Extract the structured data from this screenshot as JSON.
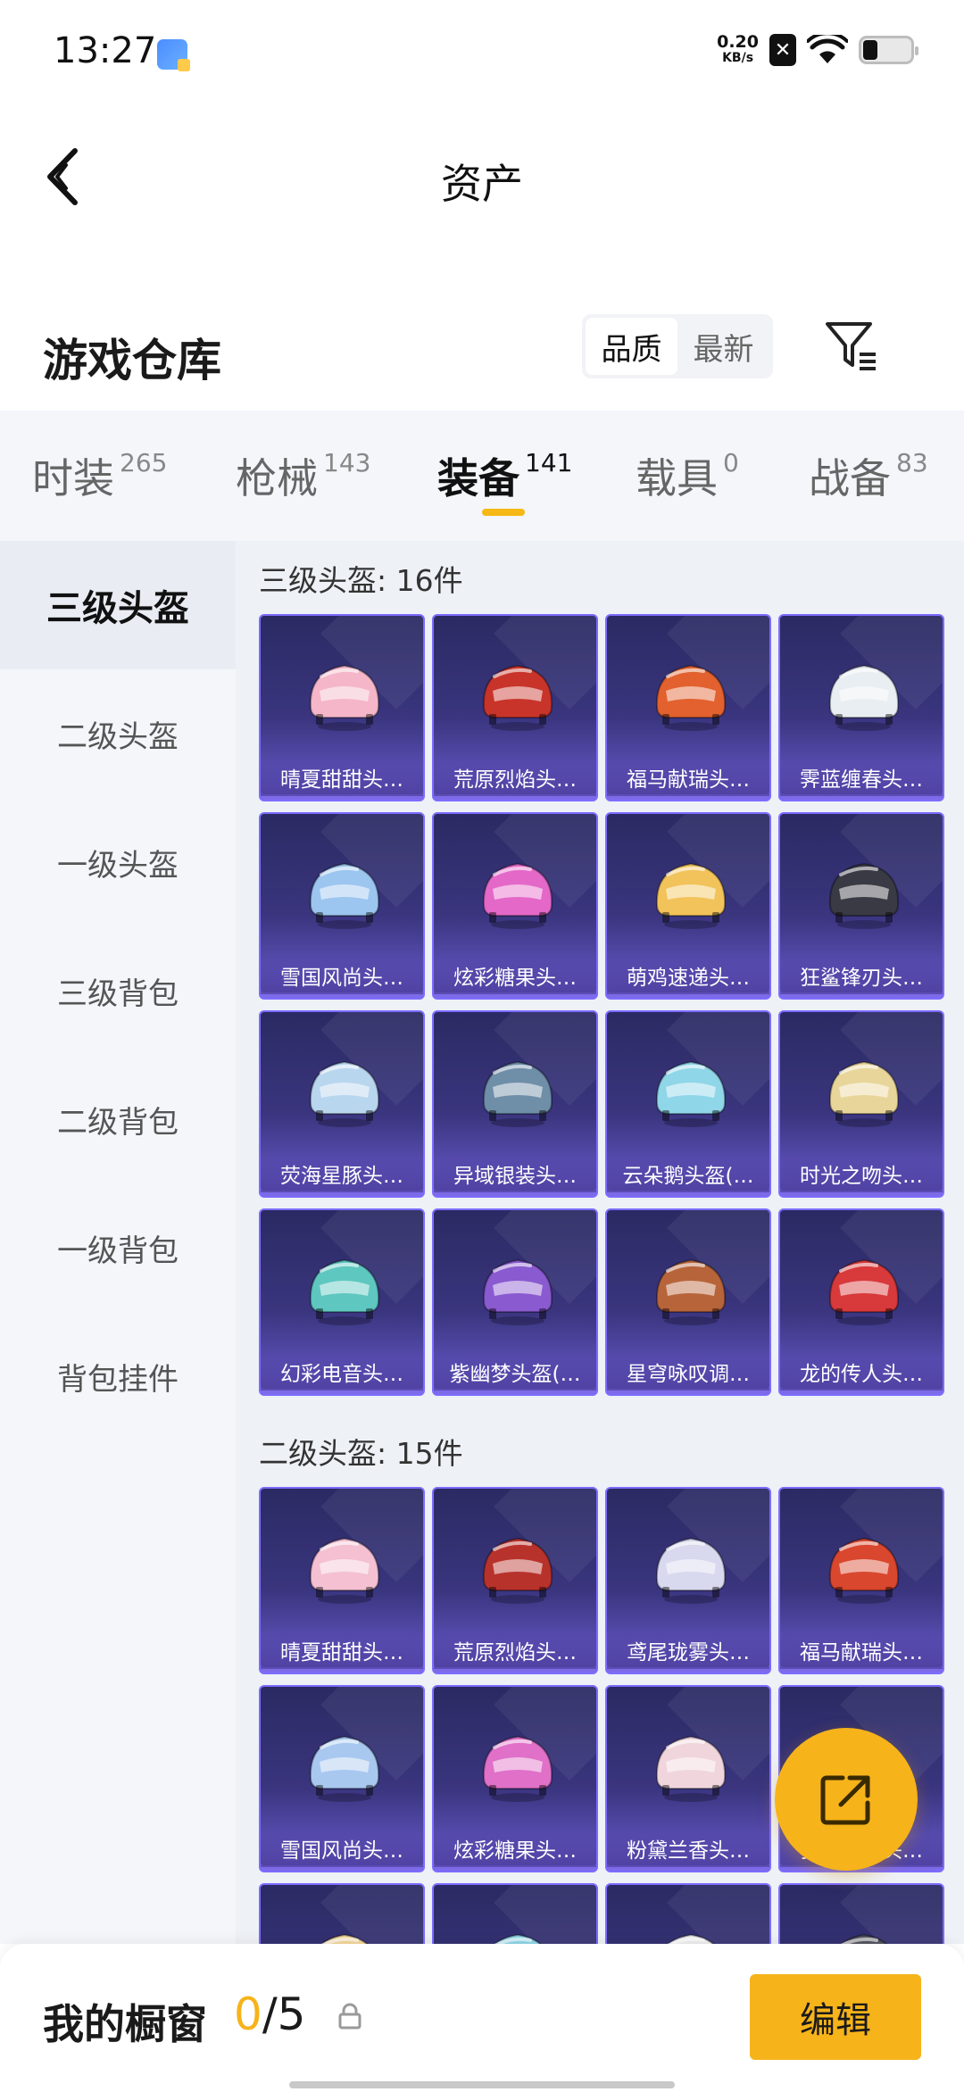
{
  "status_bar": {
    "time": "13:27",
    "net_speed_value": "0.20",
    "net_speed_unit": "KB/s"
  },
  "header": {
    "title": "资产"
  },
  "warehouse": {
    "title": "游戏仓库",
    "sort_quality": "品质",
    "sort_newest": "最新"
  },
  "categories": [
    {
      "label": "时装",
      "count": "265"
    },
    {
      "label": "枪械",
      "count": "143"
    },
    {
      "label": "装备",
      "count": "141",
      "active": true
    },
    {
      "label": "载具",
      "count": "0"
    },
    {
      "label": "战备",
      "count": "83"
    }
  ],
  "sidebar": [
    {
      "label": "三级头盔",
      "active": true
    },
    {
      "label": "二级头盔"
    },
    {
      "label": "一级头盔"
    },
    {
      "label": "三级背包"
    },
    {
      "label": "二级背包"
    },
    {
      "label": "一级背包"
    },
    {
      "label": "背包挂件"
    }
  ],
  "groups": [
    {
      "title": "三级头盔: 16件",
      "items": [
        {
          "name": "晴夏甜甜头…",
          "color": "#f4b6c8"
        },
        {
          "name": "荒原烈焰头…",
          "color": "#c8342a"
        },
        {
          "name": "福马献瑞头…",
          "color": "#e2612e"
        },
        {
          "name": "霁蓝缠春头…",
          "color": "#e9eef2"
        },
        {
          "name": "雪国风尚头…",
          "color": "#9cc6f0"
        },
        {
          "name": "炫彩糖果头…",
          "color": "#e468c8"
        },
        {
          "name": "萌鸡速递头…",
          "color": "#f2c35a"
        },
        {
          "name": "狂鲨锋刃头…",
          "color": "#3a3a44"
        },
        {
          "name": "荧海星豚头…",
          "color": "#b9d6ef"
        },
        {
          "name": "异域银装头…",
          "color": "#6f8ea8"
        },
        {
          "name": "云朵鹅头盔(…",
          "color": "#8fd6e8"
        },
        {
          "name": "时光之吻头…",
          "color": "#e8d59a"
        },
        {
          "name": "幻彩电音头…",
          "color": "#5ec7c0"
        },
        {
          "name": "紫幽梦头盔(…",
          "color": "#8a5ad0"
        },
        {
          "name": "星穹咏叹调…",
          "color": "#b8643a"
        },
        {
          "name": "龙的传人头…",
          "color": "#d8393a"
        }
      ]
    },
    {
      "title": "二级头盔: 15件",
      "items": [
        {
          "name": "晴夏甜甜头…",
          "color": "#f4c0d2"
        },
        {
          "name": "荒原烈焰头…",
          "color": "#b8322c"
        },
        {
          "name": "鸢尾珑雾头…",
          "color": "#d8d8ee"
        },
        {
          "name": "福马献瑞头…",
          "color": "#d9472e"
        },
        {
          "name": "雪国风尚头…",
          "color": "#a8c8f0"
        },
        {
          "name": "炫彩糖果头…",
          "color": "#e070c8"
        },
        {
          "name": "粉黛兰香头…",
          "color": "#f0d6dc"
        },
        {
          "name": "狂鲨锋刃头…",
          "color": "#3c3c46"
        },
        {
          "name": "",
          "color": "#f3d79a"
        },
        {
          "name": "",
          "color": "#8fd6e8"
        },
        {
          "name": "",
          "color": "#eeeeee"
        },
        {
          "name": "",
          "color": "#555560"
        }
      ]
    }
  ],
  "fab": {
    "icon": "share-external-icon"
  },
  "bottom_bar": {
    "label": "我的橱窗",
    "current": "0",
    "separator_total": "/5",
    "edit_label": "编辑"
  },
  "colors": {
    "accent": "#f6b31a",
    "card_border": "#7c6cff"
  }
}
